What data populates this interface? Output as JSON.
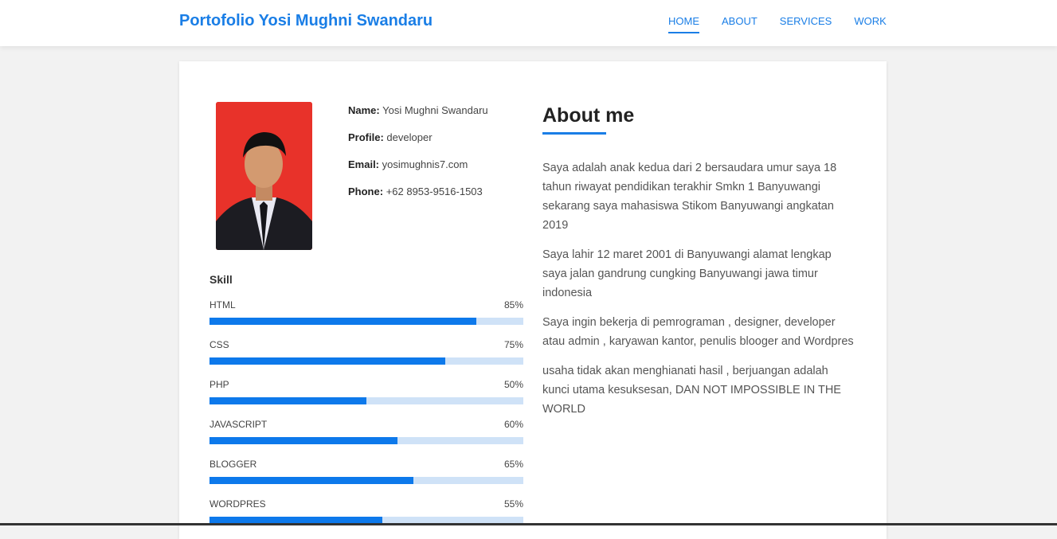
{
  "navbar": {
    "brand": "Portofolio Yosi Mughni Swandaru",
    "items": [
      {
        "label": "HOME",
        "active": true
      },
      {
        "label": "ABOUT",
        "active": false
      },
      {
        "label": "SERVICES",
        "active": false
      },
      {
        "label": "WORK",
        "active": false
      }
    ]
  },
  "profile": {
    "photo": "profile-photo",
    "fields": [
      {
        "key": "Name:",
        "value": "Yosi Mughni Swandaru"
      },
      {
        "key": "Profile:",
        "value": "developer"
      },
      {
        "key": "Email:",
        "value": "yosimughnis7.com"
      },
      {
        "key": "Phone:",
        "value": "+62 8953-9516-1503"
      }
    ]
  },
  "skills": {
    "title": "Skill",
    "items": [
      {
        "name": "HTML",
        "label": "85%",
        "percent": 85
      },
      {
        "name": "CSS",
        "label": "75%",
        "percent": 75
      },
      {
        "name": "PHP",
        "label": "50%",
        "percent": 50
      },
      {
        "name": "JAVASCRIPT",
        "label": "60%",
        "percent": 60
      },
      {
        "name": "BLOGGER",
        "label": "65%",
        "percent": 65
      },
      {
        "name": "WORDPRES",
        "label": "55%",
        "percent": 55
      }
    ]
  },
  "about": {
    "title": "About me",
    "paragraphs": [
      "Saya adalah anak kedua dari 2 bersaudara umur saya 18 tahun riwayat pendidikan terakhir Smkn 1 Banyuwangi sekarang saya mahasiswa Stikom Banyuwangi angkatan 2019",
      "Saya lahir 12 maret 2001 di Banyuwangi alamat lengkap saya jalan gandrung cungking Banyuwangi jawa timur indonesia",
      "Saya ingin bekerja di pemrograman , designer, developer atau admin , karyawan kantor, penulis blooger and Wordpres",
      "usaha tidak akan menghianati hasil , berjuangan adalah kunci utama kesuksesan, DAN NOT IMPOSSIBLE IN THE WORLD"
    ]
  },
  "colors": {
    "accent": "#1a7ee6",
    "bar_fill": "#0d79eb",
    "bar_track": "#cfe2f7",
    "photo_bg": "#e8322a"
  }
}
